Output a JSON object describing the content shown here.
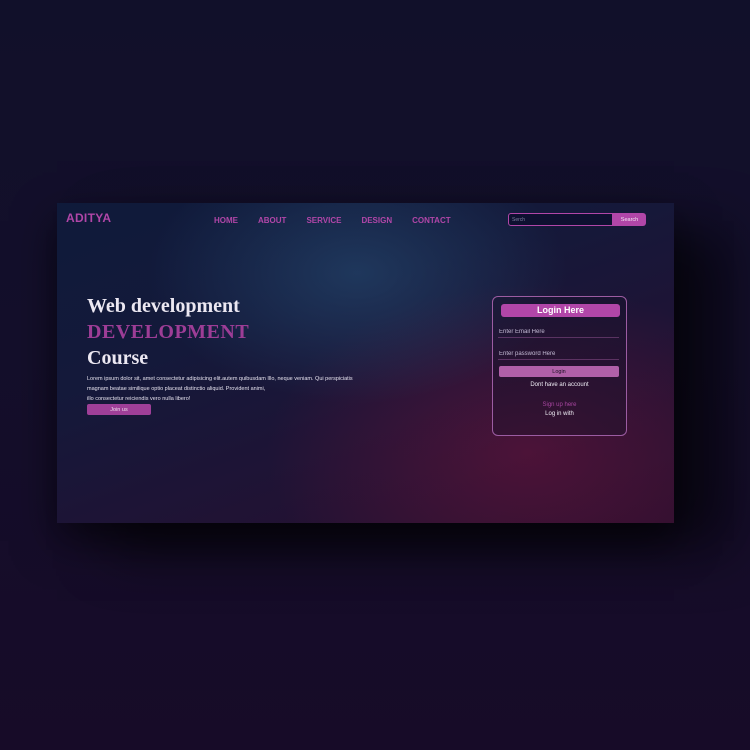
{
  "header": {
    "logo": "ADITYA",
    "nav": [
      "HOME",
      "ABOUT",
      "SERVICE",
      "DESIGN",
      "CONTACT"
    ],
    "search": {
      "placeholder": "Serch",
      "button_label": "Search"
    }
  },
  "hero": {
    "line1": "Web development",
    "line2": "DEVELOPMENT",
    "line3": "Course",
    "paragraph": [
      "Lorem ipsum dolor sit, amet consectetur adipisicing elit.autem quibusdam Illo, neque veniam. Qui perspiciatis",
      "magnam beatae similique optio placeat distinctio aliquid. Provident animi,",
      "illo consectetur reiciendis vero nulla libero!"
    ],
    "button_label": "Join us"
  },
  "login": {
    "title": "Login Here",
    "email_placeholder": "Enter Email Here",
    "password_placeholder": "Enter password Here",
    "button_label": "Login",
    "no_account_text": "Dont have an account",
    "signup_link": "Sign up here",
    "login_with_text": "Log in with"
  },
  "colors": {
    "accent": "#b146a8",
    "background": "#12102b",
    "text": "#ece8f2"
  }
}
